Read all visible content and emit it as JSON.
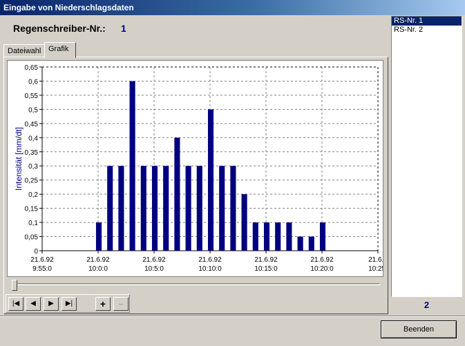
{
  "window": {
    "title": "Eingabe von Niederschlagsdaten"
  },
  "header": {
    "rs_label": "Regenschreiber-Nr.:",
    "rs_value": "1"
  },
  "tabs": [
    {
      "label": "Dateiwahl"
    },
    {
      "label": "Grafik"
    }
  ],
  "navigation": {
    "first": "|◀",
    "prev": "◀",
    "next": "▶",
    "last": "▶|",
    "plus": "+",
    "minus": "−"
  },
  "rs_list": {
    "items": [
      "RS-Nr. 1",
      "RS-Nr. 2"
    ],
    "selected": 0,
    "count": "2"
  },
  "buttons": {
    "beenden": "Beenden"
  },
  "colors": {
    "bar": "#000080",
    "selection": "#0a246a"
  },
  "chart_data": {
    "type": "bar",
    "ylabel": "Intensität  [mm/dt]",
    "ylim": [
      0,
      0.65
    ],
    "yticks": [
      "0",
      "0,05",
      "0,1",
      "0,15",
      "0,2",
      "0,25",
      "0,3",
      "0,35",
      "0,4",
      "0,45",
      "0,5",
      "0,55",
      "0,6",
      "0,65"
    ],
    "xticks": [
      {
        "date": "21.6.92",
        "time": "9:55:0"
      },
      {
        "date": "21.6.92",
        "time": "10:0:0"
      },
      {
        "date": "21.6.92",
        "time": "10:5:0"
      },
      {
        "date": "21.6.92",
        "time": "10:10:0"
      },
      {
        "date": "21.6.92",
        "time": "10:15:0"
      },
      {
        "date": "21.6.92",
        "time": "10:20:0"
      },
      {
        "date": "21.6.9",
        "time": "10:25:"
      }
    ],
    "x_minutes_per_bar": 1,
    "bar_start_minute": 5,
    "values": [
      0.1,
      0.3,
      0.3,
      0.6,
      0.3,
      0.3,
      0.3,
      0.4,
      0.3,
      0.3,
      0.5,
      0.3,
      0.3,
      0.2,
      0.1,
      0.1,
      0.1,
      0.1,
      0.05,
      0.05,
      0.1
    ],
    "grid": true
  }
}
